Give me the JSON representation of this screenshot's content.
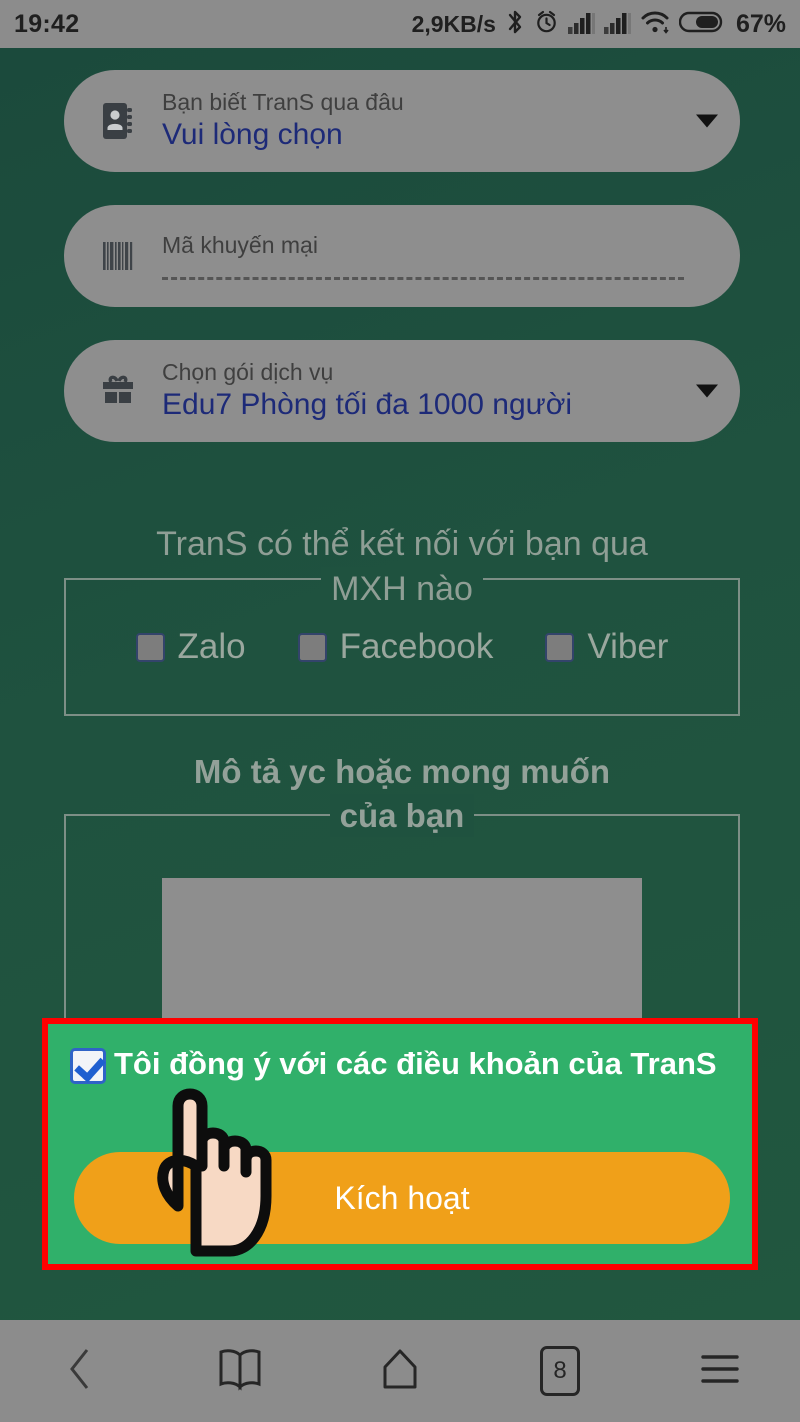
{
  "status_bar": {
    "time": "19:42",
    "network_speed": "2,9KB/s",
    "battery_percent": "67%",
    "icons": [
      "bluetooth-icon",
      "alarm-clock-icon",
      "signal-bars-icon",
      "signal-bars-icon",
      "wifi-icon",
      "battery-icon"
    ]
  },
  "form": {
    "fields": [
      {
        "icon": "contacts-book-icon",
        "label": "Bạn biết TranS qua đâu",
        "value": "Vui lòng chọn",
        "type": "select"
      },
      {
        "icon": "barcode-icon",
        "label": "Mã khuyến mại",
        "value": "",
        "type": "text"
      },
      {
        "icon": "gift-icon",
        "label": "Chọn gói dịch vụ",
        "value": "Edu7 Phòng tối đa 1000 người",
        "type": "select"
      }
    ],
    "social_group": {
      "legend_line1": "TranS có thể kết nối với bạn qua",
      "legend_line2": "MXH nào",
      "options": [
        {
          "label": "Zalo",
          "checked": false
        },
        {
          "label": "Facebook",
          "checked": false
        },
        {
          "label": "Viber",
          "checked": false
        }
      ]
    },
    "description_group": {
      "legend_line1": "Mô tả yc hoặc mong muốn",
      "legend_line2": "của bạn",
      "value": ""
    },
    "agreement": {
      "checked": true,
      "text": "Tôi đồng ý với các điều khoản của TranS"
    },
    "submit_label": "Kích hoạt"
  },
  "highlight": {
    "border_color": "#fe0000",
    "background_color": "#30b06a"
  },
  "theme": {
    "page_background": "#1f523f",
    "field_background": "#8e8e8e",
    "field_value_color": "#1d2a78",
    "submit_background": "#f0a019",
    "status_bar_background": "#8c8c8c"
  },
  "navbar": {
    "items": [
      {
        "name": "back-icon",
        "label": ""
      },
      {
        "name": "bookmarks-icon",
        "label": ""
      },
      {
        "name": "home-icon",
        "label": ""
      },
      {
        "name": "tabs-icon",
        "label": "8"
      },
      {
        "name": "menu-icon",
        "label": ""
      }
    ]
  }
}
